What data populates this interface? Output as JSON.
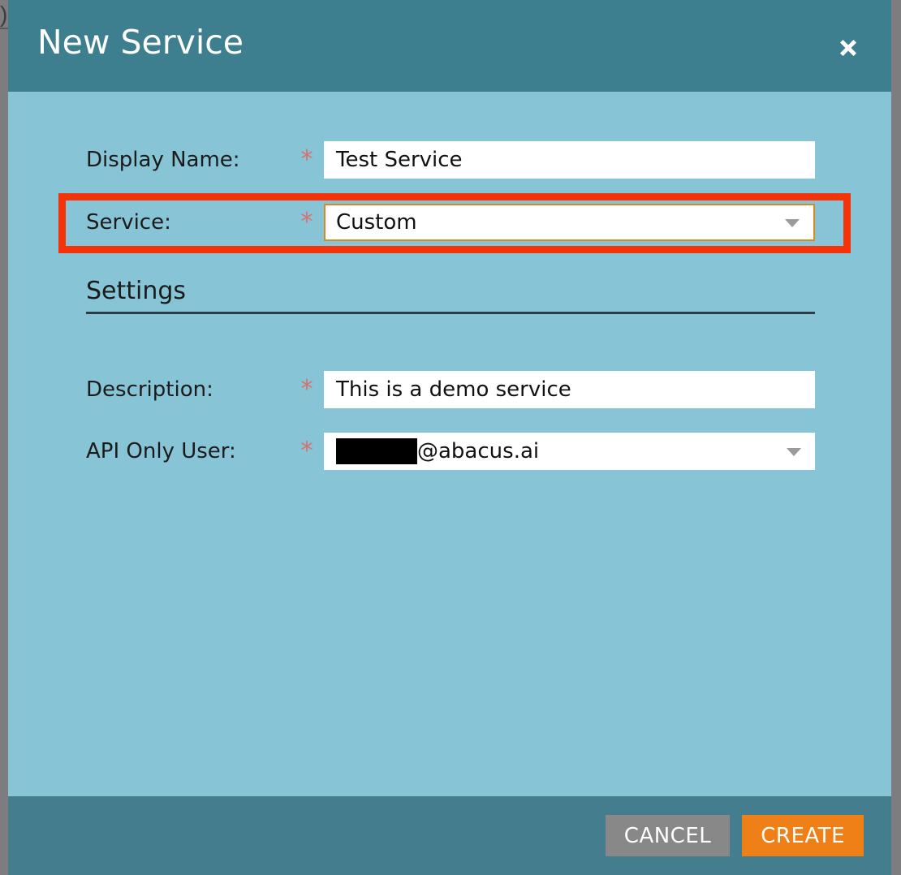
{
  "background": {
    "partial_glyph_behind_modal": ")"
  },
  "colors": {
    "header_bg": "#3d7e8f",
    "body_bg": "#87c4d6",
    "footer_bg": "#447d8e",
    "annotation_red": "#f5330a",
    "focus_border": "#d68a25",
    "required_star": "#d9706c",
    "create_button": "#ef8017",
    "cancel_button": "#888888",
    "page_bg": "#7d7d80"
  },
  "header": {
    "title": "New Service",
    "close_icon": "close-icon"
  },
  "form": {
    "fields": [
      {
        "label": "Display Name:",
        "required_marker": "*",
        "type": "text",
        "value": "Test Service",
        "focused": false
      },
      {
        "label": "Service:",
        "required_marker": "*",
        "type": "select",
        "value": "Custom",
        "focused": true,
        "caret_icon": "chevron-down-icon",
        "annotated": true
      }
    ],
    "section": {
      "title": "Settings",
      "fields": [
        {
          "label": "Description:",
          "required_marker": "*",
          "type": "text",
          "value": "This is a demo service",
          "focused": false
        },
        {
          "label": "API Only User:",
          "required_marker": "*",
          "type": "select",
          "value_redacted": true,
          "value_suffix": "@abacus.ai",
          "focused": false,
          "caret_icon": "chevron-down-icon"
        }
      ]
    }
  },
  "footer": {
    "cancel_label": "CANCEL",
    "create_label": "CREATE"
  }
}
